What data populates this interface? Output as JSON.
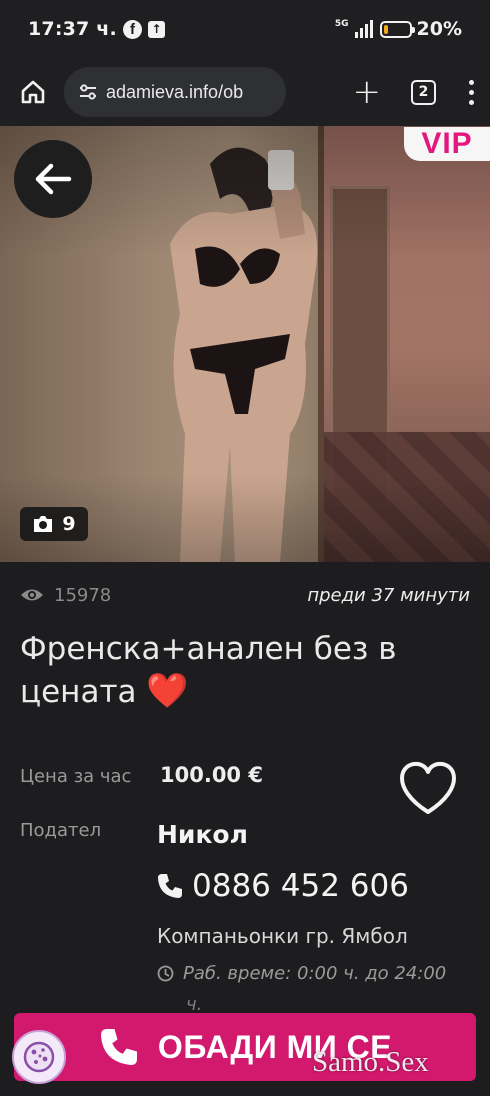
{
  "statusbar": {
    "time": "17:37 ч.",
    "network_label": "5G",
    "battery_percent": "20%",
    "battery_level": 0.2
  },
  "browser": {
    "url": "adamieva.info/ob",
    "tab_count": "2"
  },
  "hero": {
    "vip_label": "VIP",
    "photo_count": "9"
  },
  "listing": {
    "views": "15978",
    "posted": "преди 37 минути",
    "title": "Френска+анален без в цената",
    "title_emoji": "❤️",
    "price_label": "Цена за час",
    "price_value": "100.00 €",
    "provider_label": "Подател",
    "provider_name": "Никол",
    "phone": "0886 452 606",
    "category": "Компаньонки гр. Ямбол",
    "hours_line1": "Раб. време: 0:00 ч. до 24:00",
    "hours_line2": "ч."
  },
  "call_button": {
    "label": "ОБАДИ МИ СЕ"
  },
  "watermark": "Samo.Sex",
  "colors": {
    "background": "#1d1d1f",
    "accent": "#d2196d",
    "vip": "#e3177f",
    "heart": "#e51c2a"
  }
}
